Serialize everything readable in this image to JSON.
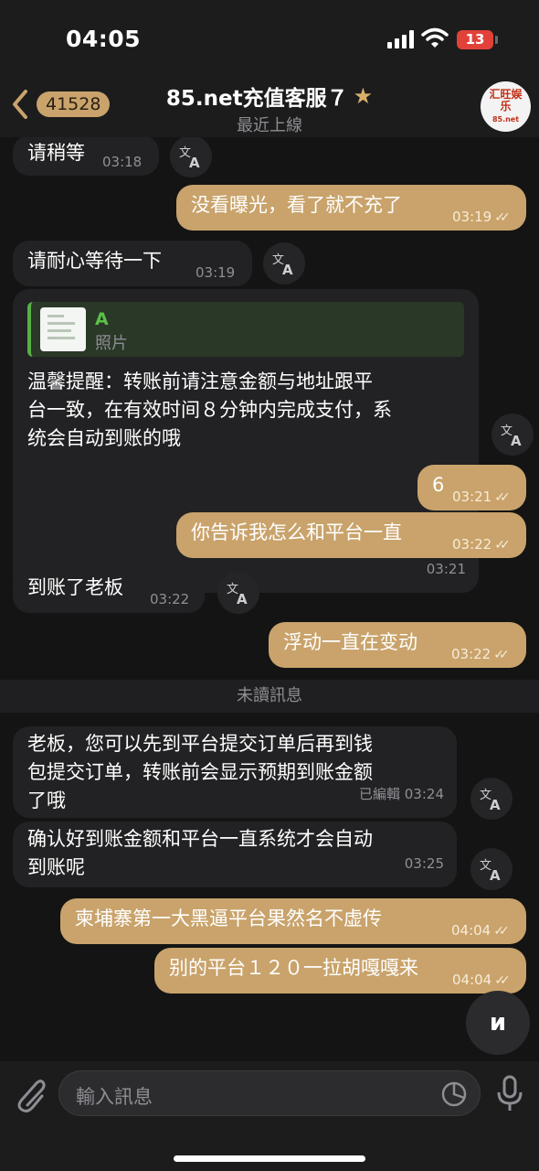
{
  "status_bar": {
    "time": "04:05",
    "battery": "13"
  },
  "header": {
    "back_count": "41528",
    "title": "85.net充值客服７",
    "subtitle": "最近上線",
    "avatar_text_top": "汇旺娱乐",
    "avatar_text_bottom": "85.net"
  },
  "messages": [
    {
      "dir": "in",
      "text": "请稍等",
      "time": "03:18"
    },
    {
      "dir": "out",
      "text": "没看曝光，看了就不充了",
      "time": "03:19"
    },
    {
      "dir": "in",
      "text": "请耐心等待一下",
      "time": "03:19"
    },
    {
      "dir": "in",
      "reply_name": "A",
      "reply_type": "照片",
      "lines": [
        "温馨提醒：转账前请注意金额与地址跟平",
        "台一致，在有效时间８分钟内完成支付，系",
        "统会自动到账的哦"
      ],
      "time": "03:21"
    },
    {
      "dir": "out",
      "text": "6",
      "time": "03:21"
    },
    {
      "dir": "out",
      "text": "你告诉我怎么和平台一直",
      "time": "03:22"
    },
    {
      "dir": "in",
      "text": "到账了老板",
      "time": "03:22"
    },
    {
      "dir": "out",
      "text": "浮动一直在变动",
      "time": "03:22"
    },
    {
      "dir": "in",
      "lines": [
        "老板，您可以先到平台提交订单后再到钱",
        "包提交订单，转账前会显示预期到账金额",
        "了哦"
      ],
      "edited": "已編輯",
      "time": "03:24"
    },
    {
      "dir": "in",
      "lines": [
        "确认好到账金额和平台一直系统才会自动",
        "到账呢"
      ],
      "time": "03:25"
    },
    {
      "dir": "out",
      "text": "柬埔寨第一大黑逼平台果然名不虚传",
      "time": "04:04"
    },
    {
      "dir": "out",
      "text": "别的平台１２０一拉胡嘎嘎来",
      "time": "04:04"
    }
  ],
  "divider": {
    "label": "未讀訊息"
  },
  "input": {
    "placeholder": "輸入訊息"
  },
  "colors": {
    "outgoing": "#c9a36b",
    "incoming": "#222224",
    "background": "#141414"
  }
}
